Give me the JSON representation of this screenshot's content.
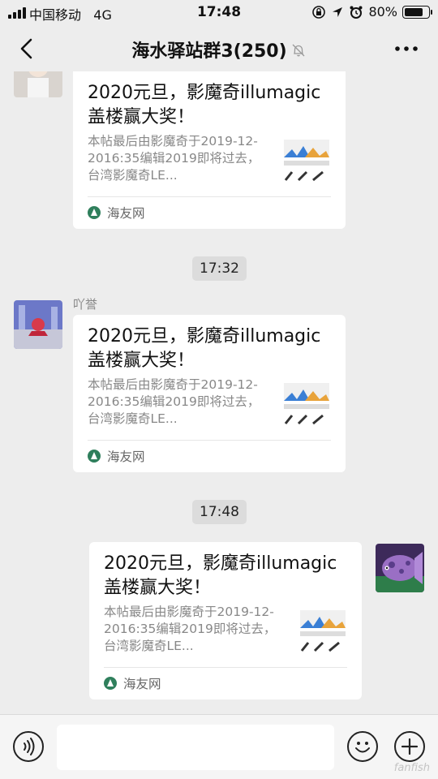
{
  "status_bar": {
    "carrier": "中国移动",
    "network": "4G",
    "time": "17:48",
    "battery_percent": "80%",
    "battery_level": 0.8
  },
  "nav": {
    "title": "海水驿站群3(250)",
    "back_icon": "chevron-left-icon",
    "mute_icon": "bell-off-icon",
    "more_icon": "more-horizontal-icon"
  },
  "messages": [
    {
      "sender": "",
      "card": {
        "title": "2020元旦，影魔奇illumagic盖楼赢大奖！",
        "description": "本帖最后由影魔奇于2019-12-2016:35编辑2019即将过去，台湾影魔奇LE...",
        "source": "海友网"
      }
    },
    {
      "sender": "吖誉",
      "card": {
        "title": "2020元旦，影魔奇illumagic盖楼赢大奖！",
        "description": "本帖最后由影魔奇于2019-12-2016:35编辑2019即将过去，台湾影魔奇LE...",
        "source": "海友网"
      }
    },
    {
      "sender": "",
      "card": {
        "title": "2020元旦，影魔奇illumagic盖楼赢大奖！",
        "description": "本帖最后由影魔奇于2019-12-2016:35编辑2019即将过去，台湾影魔奇LE...",
        "source": "海友网"
      }
    }
  ],
  "timestamps": [
    "17:32",
    "17:48"
  ],
  "input_bar": {
    "value": "",
    "voice_icon": "voice-icon",
    "emoji_icon": "emoji-icon",
    "plus_icon": "plus-icon"
  },
  "watermark": "fanfish"
}
